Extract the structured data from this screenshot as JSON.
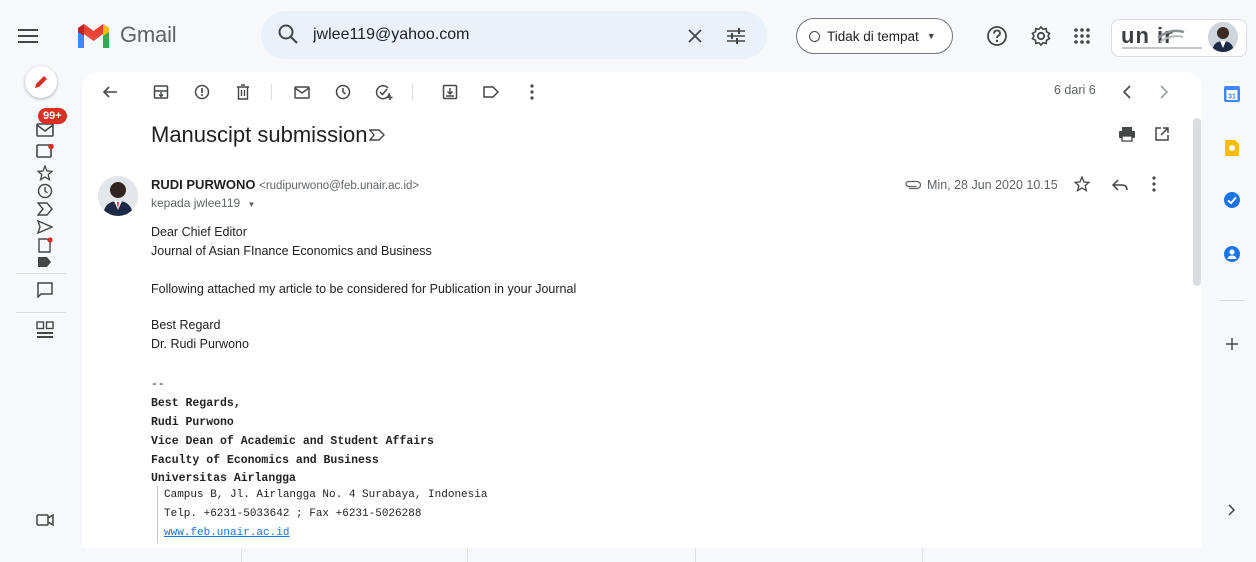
{
  "app": {
    "name": "Gmail"
  },
  "search": {
    "value": "jwlee119@yahoo.com"
  },
  "status": {
    "label": "Tidak di tempat"
  },
  "org_logo": {
    "text": "un ir"
  },
  "rail": {
    "badge": "99+"
  },
  "toolbar": {
    "pager": "6 dari 6"
  },
  "email": {
    "subject": "Manuscipt submission",
    "sender_name": "RUDI PURWONO",
    "sender_email": "<rudipurwono@feb.unair.ac.id>",
    "recipient": "kepada jwlee119",
    "date": "Min, 28 Jun 2020 10.15",
    "body": [
      "Dear Chief Editor",
      "Journal of Asian FInance Economics and Business",
      "Following attached my article to be considered for Publication in your Journal",
      "Best Regard",
      "Dr. Rudi Purwono"
    ],
    "signature": {
      "dashes": "--",
      "bold_lines": [
        "Best Regards,",
        "Rudi Purwono",
        "Vice Dean of Academic and Student Affairs",
        "Faculty of Economics and Business",
        "Universitas Airlangga"
      ],
      "address": "Campus B, Jl. Airlangga No. 4 Surabaya, Indonesia",
      "phone": "Telp. +6231-5033642 ; Fax +6231-5026288",
      "website": "www.feb.unair.ac.id"
    }
  },
  "colors": {
    "background": "#f6f8fc",
    "panel": "#ffffff",
    "accent_red": "#d93025",
    "link_blue": "#1a73e8",
    "search_bg": "#eaf1fb"
  },
  "icons": {
    "menu": "menu-icon",
    "search": "search-icon",
    "clear": "close-icon",
    "tune": "tune-icon",
    "help": "help-icon",
    "settings": "gear-icon",
    "apps": "apps-grid-icon",
    "compose": "pencil-icon",
    "print": "print-icon",
    "new_window": "open-in-new-icon",
    "star": "star-icon",
    "reply": "reply-icon"
  }
}
